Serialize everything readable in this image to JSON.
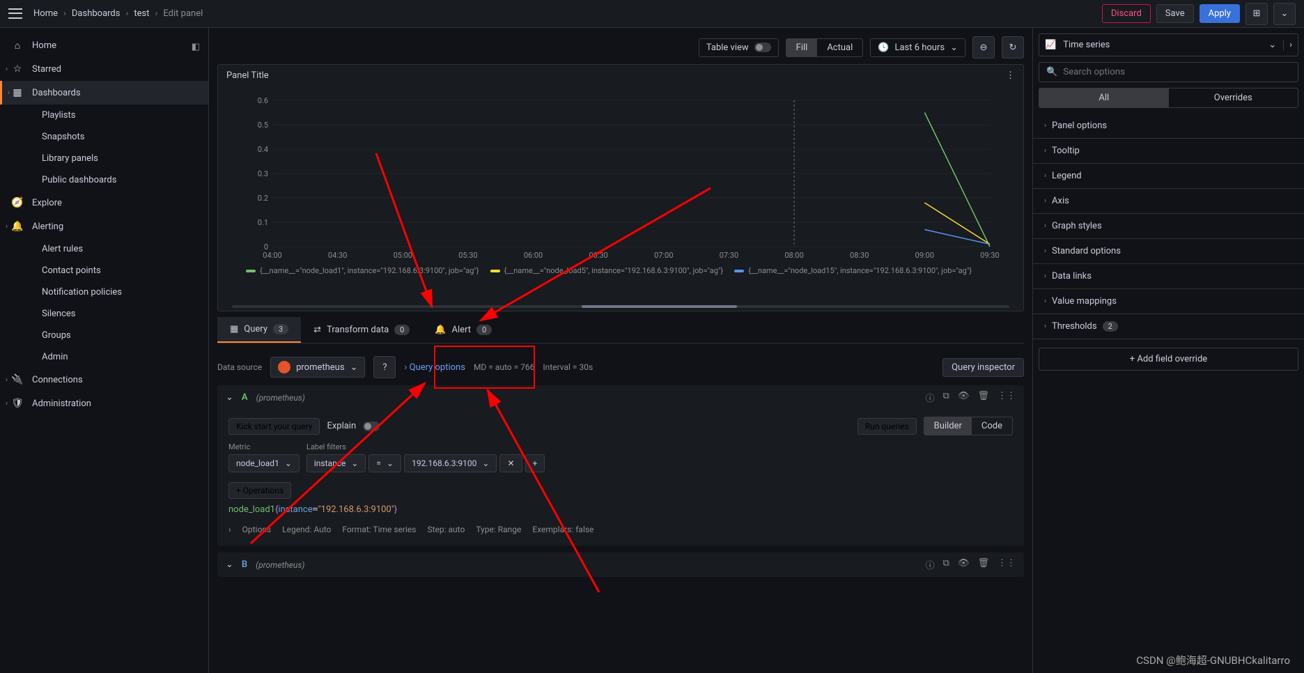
{
  "breadcrumb": [
    "Home",
    "Dashboards",
    "test",
    "Edit panel"
  ],
  "topbar": {
    "discard": "Discard",
    "save": "Save",
    "apply": "Apply"
  },
  "sidebar": {
    "items": [
      {
        "icon": "home",
        "label": "Home"
      },
      {
        "icon": "star",
        "label": "Starred",
        "chev": true
      },
      {
        "icon": "grid",
        "label": "Dashboards",
        "active": true,
        "chev": true
      },
      {
        "sub": true,
        "label": "Playlists"
      },
      {
        "sub": true,
        "label": "Snapshots"
      },
      {
        "sub": true,
        "label": "Library panels"
      },
      {
        "sub": true,
        "label": "Public dashboards"
      },
      {
        "icon": "compass",
        "label": "Explore"
      },
      {
        "icon": "bell",
        "label": "Alerting",
        "chev": true
      },
      {
        "sub": true,
        "label": "Alert rules"
      },
      {
        "sub": true,
        "label": "Contact points"
      },
      {
        "sub": true,
        "label": "Notification policies"
      },
      {
        "sub": true,
        "label": "Silences"
      },
      {
        "sub": true,
        "label": "Groups"
      },
      {
        "sub": true,
        "label": "Admin"
      },
      {
        "icon": "plug",
        "label": "Connections",
        "chev": true
      },
      {
        "icon": "shield",
        "label": "Administration",
        "chev": true
      }
    ]
  },
  "toolbar": {
    "tableview": "Table view",
    "fill": "Fill",
    "actual": "Actual",
    "timerange": "Last 6 hours"
  },
  "panel": {
    "title": "Panel Title"
  },
  "chart_data": {
    "type": "line",
    "x": [
      "04:00",
      "04:30",
      "05:00",
      "05:30",
      "06:00",
      "06:30",
      "07:00",
      "07:30",
      "08:00",
      "08:30",
      "09:00",
      "09:30"
    ],
    "ylim": [
      0,
      0.6
    ],
    "yticks": [
      0,
      0.1,
      0.2,
      0.3,
      0.4,
      0.5,
      0.6
    ],
    "series": [
      {
        "name": "{__name__=\"node_load1\", instance=\"192.168.6.3:9100\", job=\"ag\"}",
        "color": "#73BF69",
        "values": [
          null,
          null,
          null,
          null,
          null,
          null,
          null,
          null,
          null,
          null,
          0.55,
          0.0
        ]
      },
      {
        "name": "{__name__=\"node_load5\", instance=\"192.168.6.3:9100\", job=\"ag\"}",
        "color": "#FADE2A",
        "values": [
          null,
          null,
          null,
          null,
          null,
          null,
          null,
          null,
          null,
          null,
          0.18,
          0.01
        ]
      },
      {
        "name": "{__name__=\"node_load15\", instance=\"192.168.6.3:9100\", job=\"ag\"}",
        "color": "#5794F2",
        "values": [
          null,
          null,
          null,
          null,
          null,
          null,
          null,
          null,
          null,
          null,
          0.07,
          0.01
        ]
      }
    ]
  },
  "tabs": {
    "query": {
      "label": "Query",
      "count": "3"
    },
    "transform": {
      "label": "Transform data",
      "count": "0"
    },
    "alert": {
      "label": "Alert",
      "count": "0"
    }
  },
  "querybar": {
    "dslabel": "Data source",
    "dsname": "prometheus",
    "queryopts": "Query options",
    "md": "MD = auto = 766",
    "interval": "Interval = 30s",
    "inspector": "Query inspector"
  },
  "queryA": {
    "letter": "A",
    "ds": "(prometheus)",
    "kick": "Kick start your query",
    "explain": "Explain",
    "run": "Run queries",
    "builder": "Builder",
    "code": "Code",
    "metricLabel": "Metric",
    "labelfilt": "Label filters",
    "metric": "node_load1",
    "labelkey": "instance",
    "op": "=",
    "labelval": "192.168.6.3:9100",
    "operations": "Operations",
    "expr": {
      "fn": "node_load1",
      "kw": "instance",
      "str": "\"192.168.6.3:9100\""
    },
    "opts": {
      "title": "Options",
      "legend": "Legend: Auto",
      "format": "Format: Time series",
      "step": "Step: auto",
      "type": "Type: Range",
      "exemplars": "Exemplars: false"
    }
  },
  "queryB": {
    "letter": "B",
    "ds": "(prometheus)"
  },
  "right": {
    "vis": "Time series",
    "searchPH": "Search options",
    "all": "All",
    "overrides": "Overrides",
    "sections": [
      "Panel options",
      "Tooltip",
      "Legend",
      "Axis",
      "Graph styles",
      "Standard options",
      "Data links",
      "Value mappings"
    ],
    "thresholds": {
      "label": "Thresholds",
      "count": "2"
    },
    "addov": "Add field override"
  },
  "watermark": "CSDN @鲍海超-GNUBHCkalitarro"
}
